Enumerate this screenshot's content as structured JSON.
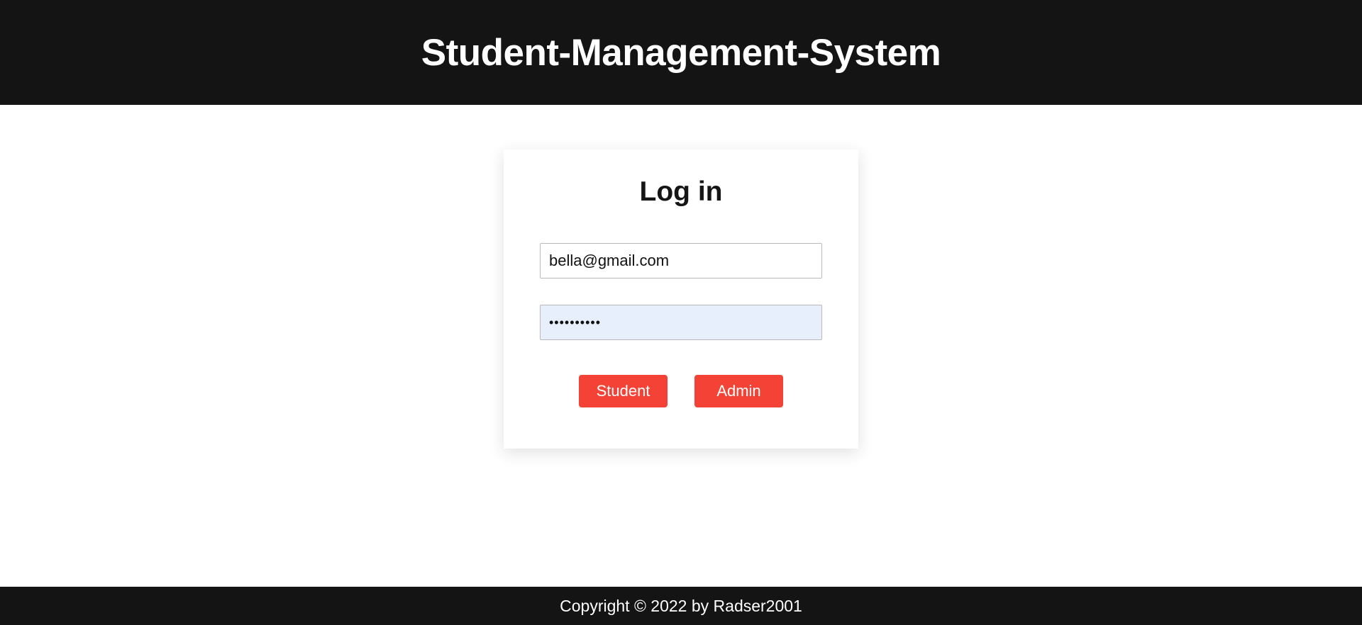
{
  "header": {
    "title": "Student-Management-System"
  },
  "login": {
    "heading": "Log in",
    "email_value": "bella@gmail.com",
    "password_value": "••••••••••",
    "student_button": "Student",
    "admin_button": "Admin"
  },
  "footer": {
    "copyright": "Copyright © 2022 by Radser2001"
  },
  "colors": {
    "header_bg": "#141414",
    "button_bg": "#f44336",
    "password_autofill_bg": "#e8effc"
  }
}
